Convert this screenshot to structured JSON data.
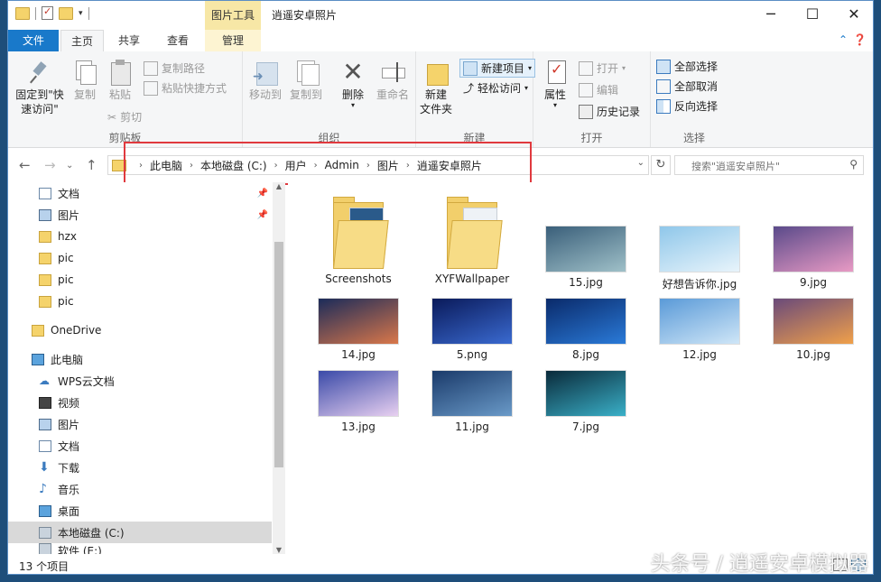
{
  "window": {
    "title": "逍遥安卓照片",
    "context_tab": "图片工具"
  },
  "tabs": [
    {
      "label": "文件"
    },
    {
      "label": "主页"
    },
    {
      "label": "共享"
    },
    {
      "label": "查看"
    },
    {
      "label": "管理"
    }
  ],
  "ribbon": {
    "clipboard": {
      "label": "剪贴板",
      "pin": "固定到\"快",
      "pin2": "速访问\"",
      "copy": "复制",
      "paste": "粘贴",
      "copy_path": "复制路径",
      "paste_shortcut": "粘贴快捷方式",
      "cut": "剪切"
    },
    "organize": {
      "label": "组织",
      "move_to": "移动到",
      "copy_to": "复制到",
      "delete": "删除",
      "rename": "重命名"
    },
    "new": {
      "label": "新建",
      "new_folder": "新建",
      "new_folder2": "文件夹",
      "new_item": "新建项目",
      "easy_access": "轻松访问"
    },
    "open": {
      "label": "打开",
      "properties": "属性",
      "open": "打开",
      "edit": "编辑",
      "history": "历史记录"
    },
    "select": {
      "label": "选择",
      "select_all": "全部选择",
      "select_none": "全部取消",
      "invert": "反向选择"
    }
  },
  "address": {
    "crumbs": [
      "此电脑",
      "本地磁盘 (C:)",
      "用户",
      "Admin",
      "图片",
      "逍遥安卓照片"
    ],
    "search_placeholder": "搜索\"逍遥安卓照片\""
  },
  "nav": {
    "quick": [
      {
        "label": "文档",
        "icon": "document-icon"
      },
      {
        "label": "图片",
        "icon": "picture-icon"
      },
      {
        "label": "hzx",
        "icon": "folder-icon"
      },
      {
        "label": "pic",
        "icon": "folder-icon"
      },
      {
        "label": "pic",
        "icon": "folder-icon"
      },
      {
        "label": "pic",
        "icon": "folder-icon"
      }
    ],
    "onedrive": "OneDrive",
    "thispc": "此电脑",
    "pc_items": [
      {
        "label": "WPS云文档",
        "icon": "cloud-icon"
      },
      {
        "label": "视频",
        "icon": "video-icon"
      },
      {
        "label": "图片",
        "icon": "picture-icon"
      },
      {
        "label": "文档",
        "icon": "document-icon"
      },
      {
        "label": "下载",
        "icon": "download-icon"
      },
      {
        "label": "音乐",
        "icon": "music-icon"
      },
      {
        "label": "桌面",
        "icon": "desktop-icon"
      },
      {
        "label": "本地磁盘 (C:)",
        "icon": "drive-icon"
      },
      {
        "label": "软件 (E:)",
        "icon": "drive-icon"
      }
    ]
  },
  "files": [
    {
      "name": "Screenshots",
      "kind": "folder"
    },
    {
      "name": "XYFWallpaper",
      "kind": "folder"
    },
    {
      "name": "15.jpg",
      "kind": "image",
      "c1": "#3a5f7a",
      "c2": "#9fc0c8"
    },
    {
      "name": "好想告诉你.jpg",
      "kind": "image",
      "c1": "#8fc7ea",
      "c2": "#e8f4fb"
    },
    {
      "name": "9.jpg",
      "kind": "image",
      "c1": "#5a4a8a",
      "c2": "#e89ac4"
    },
    {
      "name": "14.jpg",
      "kind": "image",
      "c1": "#1b2b5a",
      "c2": "#d9774a"
    },
    {
      "name": "5.png",
      "kind": "image",
      "c1": "#0a1a5a",
      "c2": "#3a6ad0"
    },
    {
      "name": "8.jpg",
      "kind": "image",
      "c1": "#0a2a6a",
      "c2": "#2a7ad8"
    },
    {
      "name": "12.jpg",
      "kind": "image",
      "c1": "#5a9ad8",
      "c2": "#cfe6f7"
    },
    {
      "name": "10.jpg",
      "kind": "image",
      "c1": "#6a4a7a",
      "c2": "#f0a04a"
    },
    {
      "name": "13.jpg",
      "kind": "image",
      "c1": "#3a4aa8",
      "c2": "#e8d0f0"
    },
    {
      "name": "11.jpg",
      "kind": "image",
      "c1": "#1a3a6a",
      "c2": "#6a9ac8"
    },
    {
      "name": "7.jpg",
      "kind": "image",
      "c1": "#0a2a3a",
      "c2": "#3ab0c8"
    }
  ],
  "status": {
    "count": "13 个项目"
  },
  "watermark": "头条号 / 逍遥安卓模拟器",
  "colors": {
    "accent": "#1979ca",
    "highlight": "#e0393e",
    "context": "#f7e7a6"
  }
}
